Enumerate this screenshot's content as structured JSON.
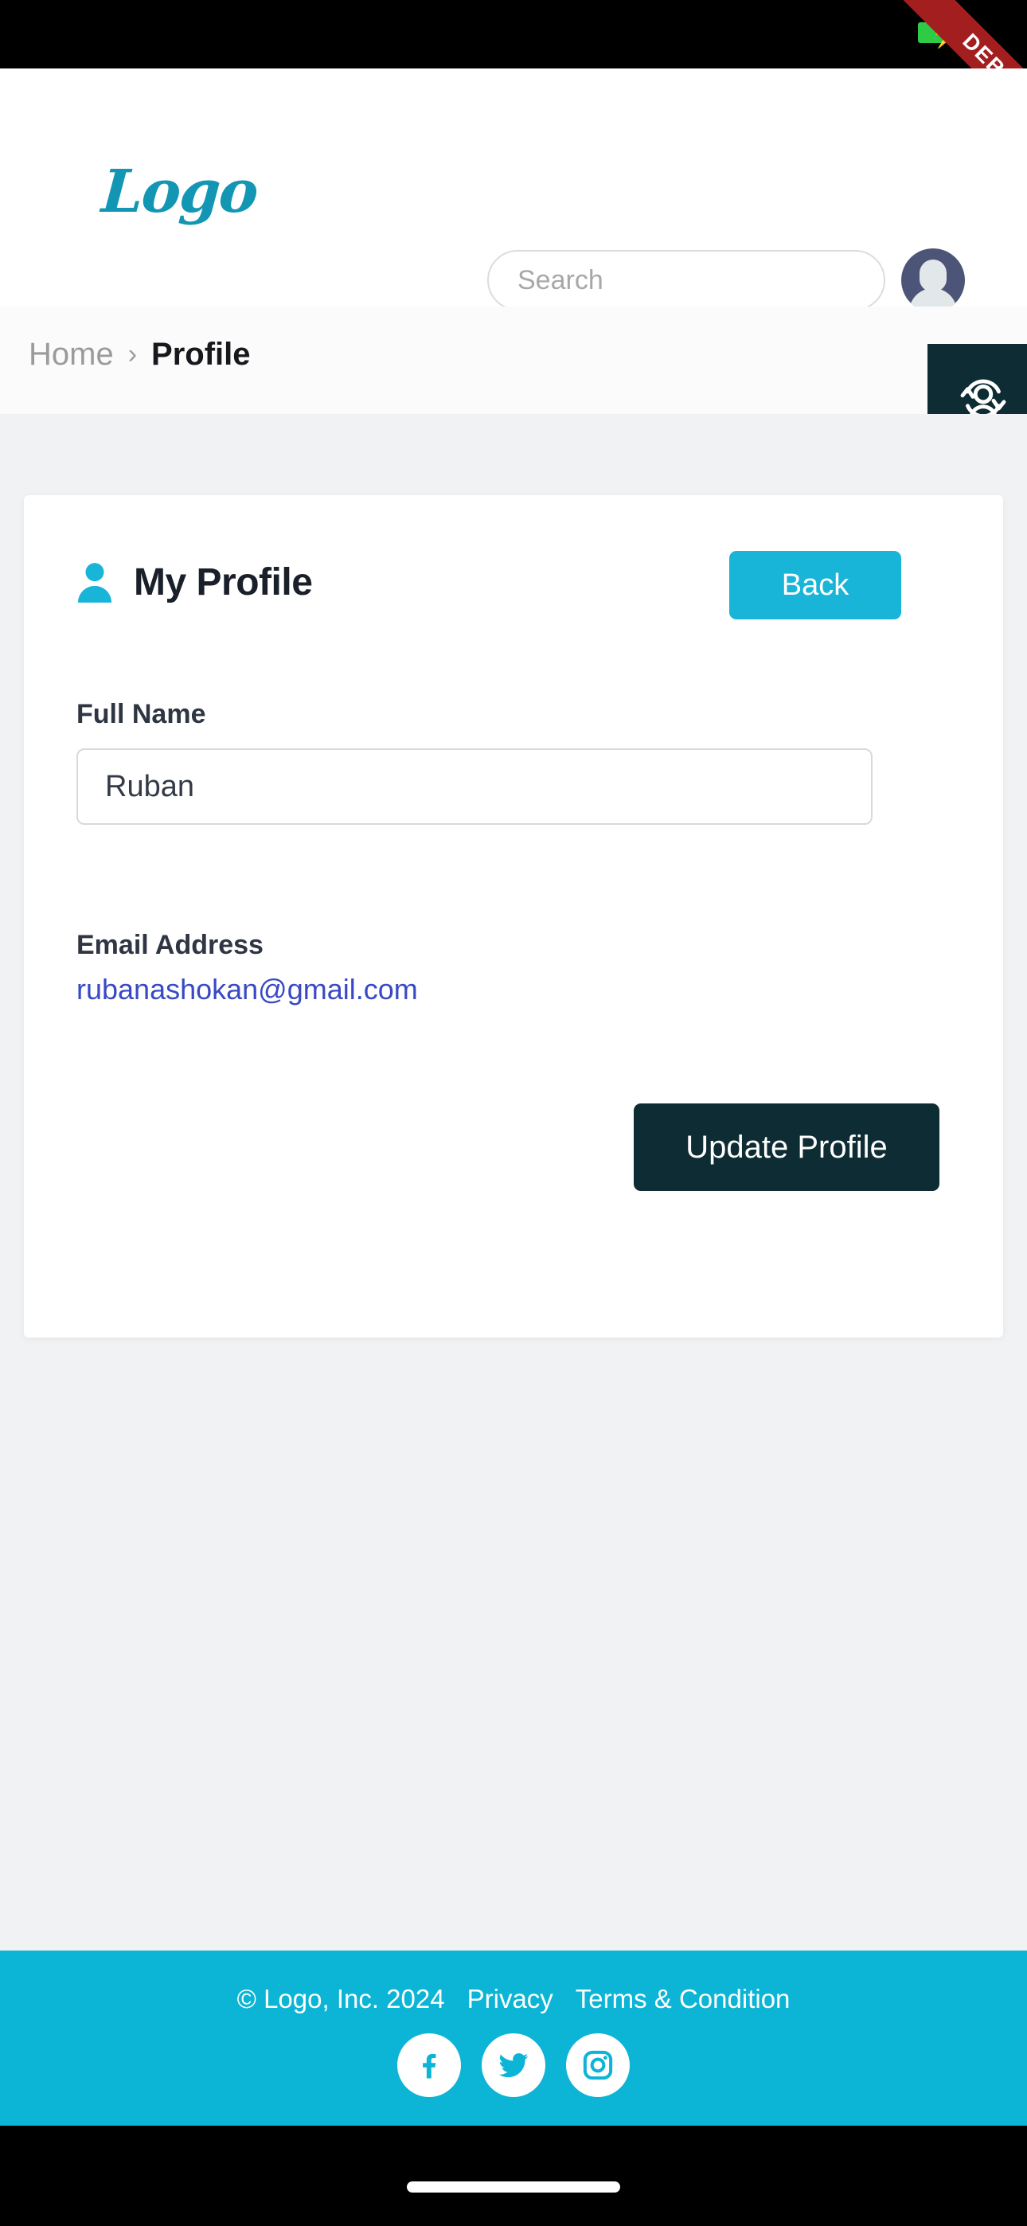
{
  "status_bar": {
    "debug_ribbon_label": "DEBUG",
    "battery_icon": "battery-charging-icon",
    "ribbon_color": "#a31f1f",
    "battery_color": "#2ecb45"
  },
  "header": {
    "logo_text": "Logo",
    "logo_color": "#1296b4",
    "search": {
      "placeholder": "Search",
      "value": "",
      "icon": "search-icon"
    },
    "avatar": {
      "icon": "user-avatar-icon",
      "background": "#4c5578"
    }
  },
  "breadcrumb": {
    "home_label": "Home",
    "separator": "›",
    "current_label": "Profile"
  },
  "switch_user_button": {
    "icon": "switch-user-icon",
    "background": "#0d2c33"
  },
  "card": {
    "title": "My Profile",
    "title_icon": "person-icon",
    "title_icon_color": "#18b5d8",
    "back_button_label": "Back",
    "back_button_color": "#18b5d8",
    "fields": {
      "full_name_label": "Full Name",
      "full_name_value": "Ruban",
      "full_name_placeholder": "Full Name",
      "email_label": "Email Address",
      "email_value": "rubanashokan@gmail.com",
      "email_color": "#3949c4"
    },
    "update_button_label": "Update Profile",
    "update_button_color": "#0d2c33"
  },
  "footer": {
    "background": "#0cb4d6",
    "copyright": "© Logo, Inc. 2024",
    "privacy_label": "Privacy",
    "terms_label": "Terms & Condition",
    "social": [
      {
        "name": "facebook-icon"
      },
      {
        "name": "twitter-icon"
      },
      {
        "name": "instagram-icon"
      }
    ]
  },
  "page": {
    "background": "#f1f2f4"
  }
}
